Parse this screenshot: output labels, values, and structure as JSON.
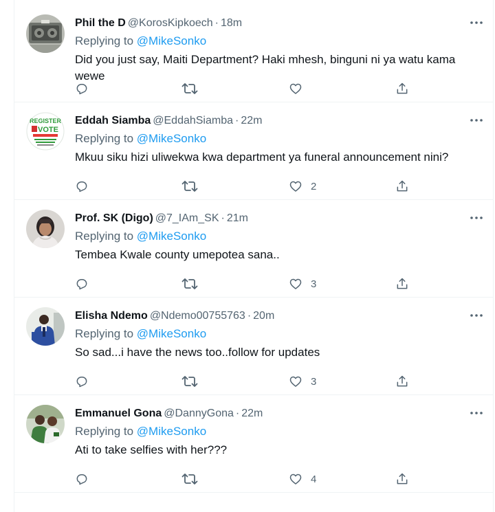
{
  "tweets": [
    {
      "name": "Phil the D",
      "handle": "@KorosKipkoech",
      "separator": "·",
      "time": "18m",
      "replying_prefix": "Replying to",
      "replying_to": "@MikeSonko",
      "text": "Did you just say, Maiti Department? Haki mhesh, binguni ni ya watu kama wewe",
      "likes": ""
    },
    {
      "name": "Eddah Siamba",
      "handle": "@EddahSiamba",
      "separator": "·",
      "time": "22m",
      "replying_prefix": "Replying to",
      "replying_to": "@MikeSonko",
      "text": "Mkuu siku hizi uliwekwa kwa department ya funeral announcement nini?",
      "likes": "2",
      "avatar_text": [
        "REGISTER",
        "VOTE"
      ]
    },
    {
      "name": "Prof. SK (Digo)",
      "handle": "@7_IAm_SK",
      "separator": "·",
      "time": "21m",
      "replying_prefix": "Replying to",
      "replying_to": "@MikeSonko",
      "text": "Tembea Kwale county umepotea sana..",
      "likes": "3"
    },
    {
      "name": "Elisha Ndemo",
      "handle": "@Ndemo00755763",
      "separator": "·",
      "time": "20m",
      "replying_prefix": "Replying to",
      "replying_to": "@MikeSonko",
      "text": "So sad...i have the news too..follow for updates",
      "likes": "3"
    },
    {
      "name": "Emmanuel Gona",
      "handle": "@DannyGona",
      "separator": "·",
      "time": "22m",
      "replying_prefix": "Replying to",
      "replying_to": "@MikeSonko",
      "text": "Ati to take selfies with her???",
      "likes": "4"
    }
  ],
  "icons": {
    "more": "more-dots-icon",
    "reply": "reply-icon",
    "retweet": "retweet-icon",
    "like": "heart-icon",
    "share": "share-icon"
  },
  "colors": {
    "text_primary": "#0f1419",
    "text_secondary": "#536471",
    "mention": "#1d9bf0",
    "border": "#eff3f4"
  }
}
